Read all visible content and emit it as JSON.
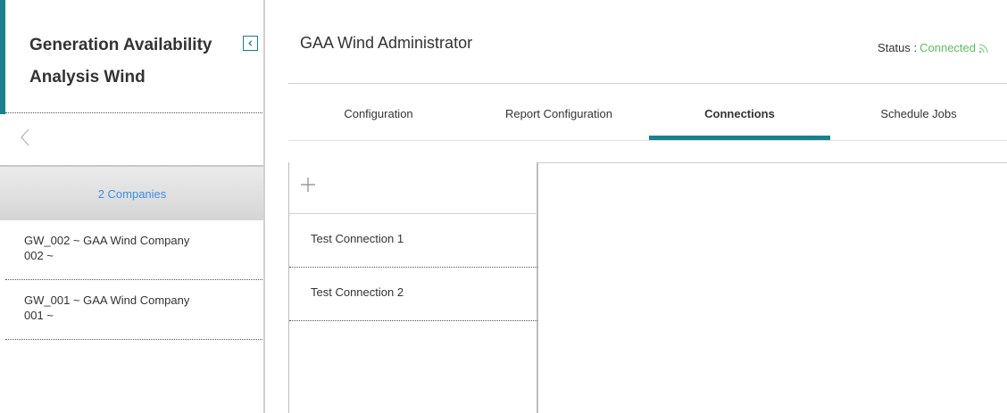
{
  "sidebar": {
    "title": "Generation Availability Analysis Wind",
    "companies_header": "2 Companies",
    "companies": [
      {
        "label": "GW_002 ~ GAA Wind Company 002 ~"
      },
      {
        "label": "GW_001 ~ GAA Wind Company 001 ~"
      }
    ]
  },
  "header": {
    "title": "GAA Wind Administrator",
    "status_label": "Status :",
    "status_value": "Connected"
  },
  "tabs": [
    {
      "label": "Configuration"
    },
    {
      "label": "Report Configuration"
    },
    {
      "label": "Connections",
      "active": true
    },
    {
      "label": "Schedule Jobs"
    }
  ],
  "connections": [
    {
      "label": "Test Connection 1"
    },
    {
      "label": "Test Connection 2"
    }
  ],
  "colors": {
    "accent": "#1a7f8e",
    "status_connected": "#5bbf5b",
    "link": "#3f8ee6"
  },
  "icons": {
    "collapse": "chevron-left-box-icon",
    "back": "chevron-left-icon",
    "add": "plus-icon",
    "status": "rss-icon"
  }
}
